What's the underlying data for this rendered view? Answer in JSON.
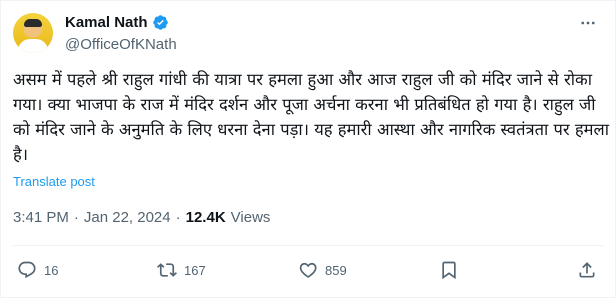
{
  "author": {
    "display_name": "Kamal Nath",
    "handle": "@OfficeOfKNath",
    "verified_color": "#1d9bf0"
  },
  "tweet": {
    "text": "असम में पहले श्री राहुल गांधी की यात्रा पर हमला हुआ और आज राहुल जी को मंदिर जाने से रोका गया। क्या भाजपा के राज में मंदिर दर्शन और पूजा अर्चना करना भी प्रतिबंधित हो गया है। राहुल जी को मंदिर जाने के अनुमति के लिए धरना देना पड़ा। यह हमारी आस्था और नागरिक स्वतंत्रता पर हमला है।",
    "translate_label": "Translate post",
    "time": "3:41 PM",
    "separator": "·",
    "date": "Jan 22, 2024",
    "views_count": "12.4K",
    "views_label": "Views"
  },
  "actions": {
    "replies": "16",
    "reposts": "167",
    "likes": "859"
  },
  "colors": {
    "text": "#0f1419",
    "secondary": "#536471",
    "link": "#1d9bf0"
  }
}
